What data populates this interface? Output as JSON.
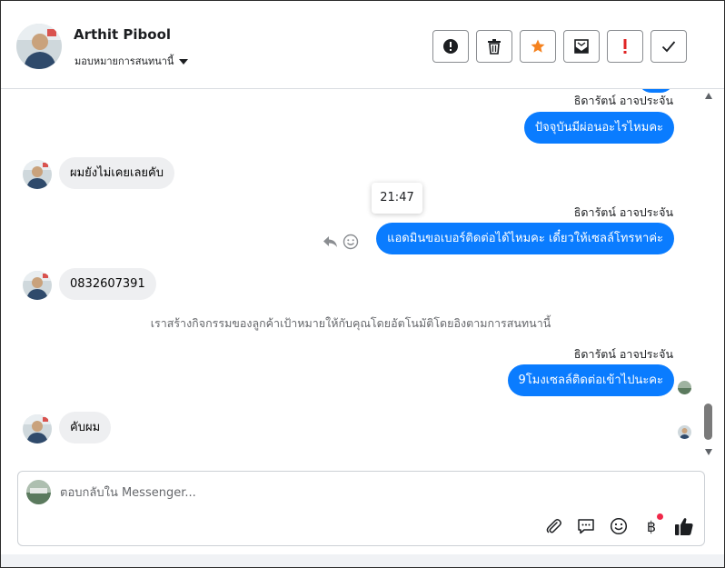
{
  "header": {
    "contact_name": "Arthit Pibool",
    "assign_label": "มอบหมายการสนทนานี้"
  },
  "toolbar": {
    "buttons": [
      "report-spam",
      "delete",
      "star",
      "mark-unread",
      "important",
      "mark-done"
    ],
    "star_color": "#f5821f",
    "important_color": "#e02424"
  },
  "messages": {
    "agent_name": "ธิดารัตน์ อาจประจัน",
    "items": [
      {
        "from": "agent",
        "text": "ปัจจุบันมีผ่อนอะไรไหมคะ"
      },
      {
        "from": "customer",
        "text": "ผมยังไม่เคยเลยคับ"
      },
      {
        "from": "agent",
        "text": "แอดมินขอเบอร์ติดต่อได้ไหมคะ เดี๋ยวให้เซลล์โทรหาค่ะ"
      },
      {
        "from": "customer",
        "text": "0832607391"
      },
      {
        "from": "agent",
        "text": "9โมงเซลล์ติดต่อเข้าไปนะคะ"
      },
      {
        "from": "customer",
        "text": "คับผม"
      }
    ],
    "tooltip_time": "21:47",
    "system_note": "เราสร้างกิจกรรมของลูกค้าเป้าหมายให้กับคุณโดยอัตโนมัติโดยอิงตามการสนทนานี้"
  },
  "composer": {
    "placeholder": "ตอบกลับใน Messenger...",
    "value": "",
    "currency_symbol": "฿"
  },
  "colors": {
    "outgoing_bubble": "#0a7cff",
    "incoming_bubble": "#eeeff1",
    "notification_dot": "#f02849"
  }
}
